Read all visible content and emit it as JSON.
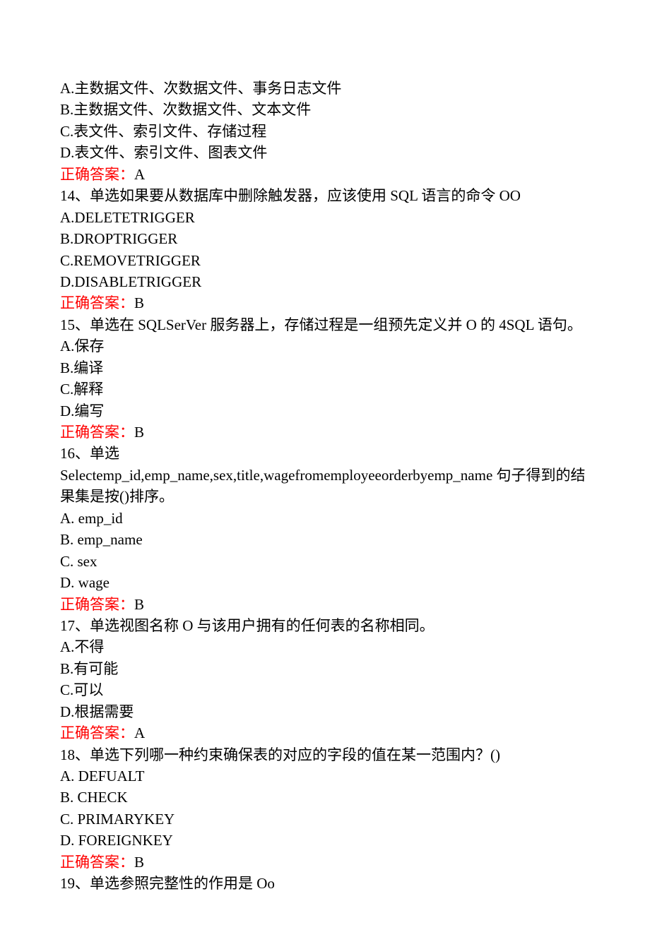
{
  "q13": {
    "optA": "A.主数据文件、次数据文件、事务日志文件",
    "optB": "B.主数据文件、次数据文件、文本文件",
    "optC": "C.表文件、索引文件、存储过程",
    "optD": "D.表文件、索引文件、图表文件",
    "answerLabel": "正确答案：",
    "answerValue": "A"
  },
  "q14": {
    "stem": "14、单选如果要从数据库中删除触发器，应该使用 SQL 语言的命令 OO",
    "optA": "A.DELETETRIGGER",
    "optB": "B.DROPTRIGGER",
    "optC": "C.REMOVETRIGGER",
    "optD": "D.DISABLETRIGGER",
    "answerLabel": "正确答案：",
    "answerValue": "B"
  },
  "q15": {
    "stem": "15、单选在 SQLSerVer 服务器上，存储过程是一组预先定义并 O 的 4SQL 语句。",
    "optA": "A.保存",
    "optB": "B.编译",
    "optC": "C.解释",
    "optD": "D.编写",
    "answerLabel": "正确答案：",
    "answerValue": "B"
  },
  "q16": {
    "stemLine1": "16、单选",
    "stemLine2": "Selectemp_id,emp_name,sex,title,wagefromemployeeorderbyemp_name 句子得到的结果集是按()排序。",
    "optA": "A. emp_id",
    "optB": "B. emp_name",
    "optC": "C. sex",
    "optD": "D. wage",
    "answerLabel": "正确答案：",
    "answerValue": "B"
  },
  "q17": {
    "stem": "17、单选视图名称 O 与该用户拥有的任何表的名称相同。",
    "optA": "A.不得",
    "optB": "B.有可能",
    "optC": "C.可以",
    "optD": "D.根据需要",
    "answerLabel": "正确答案：",
    "answerValue": "A"
  },
  "q18": {
    "stem": "18、单选下列哪一种约束确保表的对应的字段的值在某一范围内？()",
    "optA": "A. DEFUALT",
    "optB": "B. CHECK",
    "optC": "C. PRIMARYKEY",
    "optD": "D. FOREIGNKEY",
    "answerLabel": "正确答案：",
    "answerValue": "B"
  },
  "q19": {
    "stem": "19、单选参照完整性的作用是 Oo"
  }
}
